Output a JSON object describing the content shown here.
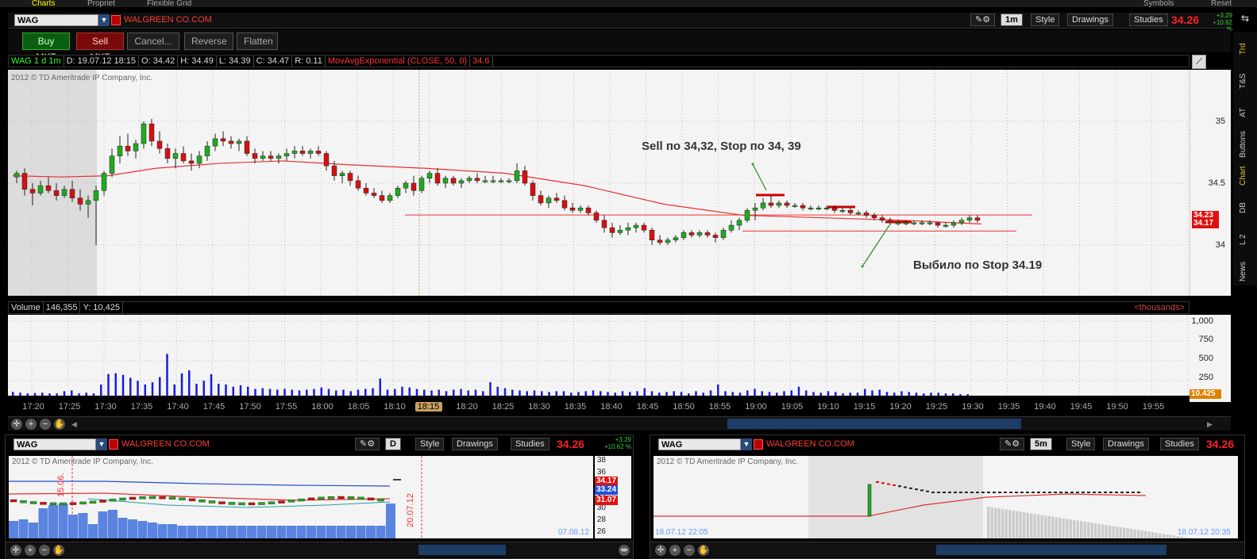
{
  "topbar": {
    "items": [
      "Charts",
      "Propriet",
      "Flexible Grid"
    ],
    "right": [
      "Symbols",
      "Reset"
    ]
  },
  "main": {
    "symbol": "WAG",
    "company": "WALGREEN CO.COM",
    "timeframe": "1m",
    "style": "Style",
    "drawings": "Drawings",
    "studies": "Studies",
    "last": "34.26",
    "chg_up": "+3.29",
    "chg_pct": "+10.62 %",
    "buttons": {
      "buy": "Buy MKT",
      "sell": "Sell MKT",
      "cancel": "Cancel...",
      "reverse": "Reverse",
      "flatten": "Flatten"
    },
    "info": {
      "title": "WAG 1 d 1m",
      "date": "D: 19.07.12 18:15",
      "open": "O: 34.42",
      "high": "H: 34.49",
      "low": "L: 34.39",
      "close": "C: 34.47",
      "range": "R: 0.11",
      "study": "MovAvgExponential (CLOSE, 50, 0)",
      "study_val": "34.6"
    },
    "copyright": "2012 © TD Ameritrade IP Company, Inc.",
    "price_axis": [
      "35",
      "34.5",
      "34"
    ],
    "badges": {
      "a": "34.23",
      "b": "34.17"
    },
    "annotation1": "Sell по 34,32, Stop по 34, 39",
    "annotation2": "Выбило по Stop 34.19",
    "volume": {
      "label": "Volume",
      "value": "146,355",
      "y": "Y: 10,425",
      "unit": "<thousands>",
      "axis": [
        "1,000",
        "750",
        "500",
        "250"
      ],
      "badge": "10.425"
    },
    "time_axis": [
      "17:20",
      "17:25",
      "17:30",
      "17:35",
      "17:40",
      "17:45",
      "17:50",
      "17:55",
      "18:00",
      "18:05",
      "18:10",
      "18:15",
      "18:20",
      "18:25",
      "18:30",
      "18:35",
      "18:40",
      "18:45",
      "18:50",
      "18:55",
      "19:00",
      "19:05",
      "19:10",
      "19:15",
      "19:20",
      "19:25",
      "19:30",
      "19:35",
      "19:40",
      "19:45",
      "19:50",
      "19:55"
    ],
    "cursor_time": "18:15"
  },
  "side_tabs": [
    "Trd",
    "T&S",
    "AT",
    "Buttons",
    "Chart",
    "DB",
    "L 2",
    "News"
  ],
  "bottom_left": {
    "symbol": "WAG",
    "company": "WALGREEN CO.COM",
    "tf": "D",
    "style": "Style",
    "drawings": "Drawings",
    "studies": "Studies",
    "last": "34.26",
    "chg_up": "+3.29",
    "chg_pct": "+10.62 %",
    "copyright": "2012 © TD Ameritrade IP Company, Inc.",
    "axis": [
      "38",
      "36",
      "34",
      "32",
      "30",
      "28",
      "26"
    ],
    "badges": [
      "34.17",
      "33.24",
      "31.07"
    ],
    "date1": "15.06.",
    "date2": "20.07.12",
    "footer": "07.08.12"
  },
  "bottom_right": {
    "symbol": "WAG",
    "company": "WALGREEN CO.COM",
    "tf": "5m",
    "style": "Style",
    "drawings": "Drawings",
    "studies": "Studies",
    "last": "34.26",
    "copyright": "2012 © TD Ameritrade IP Company, Inc.",
    "footer_left": "18.07.12 22:05",
    "footer_right": "18.07.12 20:35"
  },
  "chart_data": {
    "type": "candlestick",
    "note_prices": {
      "sell": 34.32,
      "stop": 34.39,
      "exit": 34.19
    },
    "ema": [
      [
        0,
        34.56
      ],
      [
        60,
        34.55
      ],
      [
        120,
        34.56
      ],
      [
        180,
        34.62
      ],
      [
        260,
        34.66
      ],
      [
        340,
        34.68
      ],
      [
        420,
        34.65
      ],
      [
        520,
        34.62
      ],
      [
        620,
        34.58
      ],
      [
        720,
        34.48
      ],
      [
        820,
        34.33
      ],
      [
        920,
        34.24
      ],
      [
        1020,
        34.22
      ],
      [
        1120,
        34.2
      ],
      [
        1220,
        34.17
      ]
    ],
    "candles": [
      [
        5,
        34.55,
        34.6,
        34.5,
        34.58
      ],
      [
        15,
        34.58,
        34.62,
        34.4,
        34.45
      ],
      [
        25,
        34.45,
        34.5,
        34.32,
        34.42
      ],
      [
        35,
        34.42,
        34.52,
        34.4,
        34.48
      ],
      [
        45,
        34.48,
        34.55,
        34.42,
        34.44
      ],
      [
        55,
        34.44,
        34.5,
        34.36,
        34.4
      ],
      [
        65,
        34.4,
        34.48,
        34.38,
        34.45
      ],
      [
        75,
        34.45,
        34.52,
        34.35,
        34.38
      ],
      [
        85,
        34.38,
        34.45,
        34.28,
        34.33
      ],
      [
        95,
        34.33,
        34.4,
        34.22,
        34.36
      ],
      [
        105,
        34.36,
        34.48,
        34.0,
        34.44
      ],
      [
        115,
        34.44,
        34.6,
        34.4,
        34.58
      ],
      [
        125,
        34.58,
        34.78,
        34.55,
        34.72
      ],
      [
        135,
        34.72,
        34.88,
        34.66,
        34.8
      ],
      [
        145,
        34.8,
        34.9,
        34.72,
        34.76
      ],
      [
        155,
        34.76,
        34.85,
        34.7,
        34.82
      ],
      [
        165,
        34.82,
        35.0,
        34.78,
        34.98
      ],
      [
        175,
        34.98,
        35.02,
        34.8,
        34.84
      ],
      [
        185,
        34.84,
        34.92,
        34.74,
        34.78
      ],
      [
        195,
        34.78,
        34.82,
        34.66,
        34.7
      ],
      [
        205,
        34.7,
        34.78,
        34.62,
        34.74
      ],
      [
        215,
        34.74,
        34.8,
        34.66,
        34.68
      ],
      [
        225,
        34.68,
        34.74,
        34.6,
        34.66
      ],
      [
        235,
        34.66,
        34.76,
        34.62,
        34.72
      ],
      [
        245,
        34.72,
        34.84,
        34.68,
        34.8
      ],
      [
        255,
        34.8,
        34.9,
        34.76,
        34.86
      ],
      [
        265,
        34.86,
        34.92,
        34.8,
        34.84
      ],
      [
        275,
        34.84,
        34.88,
        34.78,
        34.82
      ],
      [
        285,
        34.82,
        34.86,
        34.76,
        34.84
      ],
      [
        295,
        34.84,
        34.88,
        34.72,
        34.74
      ],
      [
        305,
        34.74,
        34.78,
        34.66,
        34.7
      ],
      [
        315,
        34.7,
        34.76,
        34.68,
        34.72
      ],
      [
        325,
        34.72,
        34.76,
        34.68,
        34.7
      ],
      [
        335,
        34.7,
        34.74,
        34.66,
        34.72
      ],
      [
        345,
        34.72,
        34.78,
        34.68,
        34.74
      ],
      [
        355,
        34.74,
        34.8,
        34.7,
        34.76
      ],
      [
        365,
        34.76,
        34.8,
        34.72,
        34.74
      ],
      [
        375,
        34.74,
        34.78,
        34.7,
        34.76
      ],
      [
        385,
        34.76,
        34.8,
        34.72,
        34.74
      ],
      [
        395,
        34.74,
        34.76,
        34.6,
        34.64
      ],
      [
        405,
        34.64,
        34.68,
        34.52,
        34.56
      ],
      [
        415,
        34.56,
        34.6,
        34.5,
        34.58
      ],
      [
        425,
        34.58,
        34.6,
        34.48,
        34.52
      ],
      [
        435,
        34.52,
        34.56,
        34.44,
        34.46
      ],
      [
        445,
        34.46,
        34.5,
        34.4,
        34.42
      ],
      [
        455,
        34.42,
        34.46,
        34.38,
        34.4
      ],
      [
        465,
        34.4,
        34.44,
        34.34,
        34.36
      ],
      [
        475,
        34.36,
        34.42,
        34.34,
        34.4
      ],
      [
        485,
        34.4,
        34.48,
        34.38,
        34.46
      ],
      [
        495,
        34.46,
        34.52,
        34.42,
        34.5
      ],
      [
        505,
        34.5,
        34.56,
        34.4,
        34.44
      ],
      [
        515,
        34.44,
        34.56,
        34.42,
        34.54
      ],
      [
        525,
        34.54,
        34.6,
        34.5,
        34.58
      ],
      [
        535,
        34.58,
        34.62,
        34.48,
        34.5
      ],
      [
        545,
        34.5,
        34.56,
        34.46,
        34.54
      ],
      [
        555,
        34.54,
        34.56,
        34.48,
        34.5
      ],
      [
        565,
        34.5,
        34.54,
        34.46,
        34.52
      ],
      [
        575,
        34.52,
        34.56,
        34.5,
        34.54
      ],
      [
        585,
        34.54,
        34.58,
        34.5,
        34.52
      ],
      [
        595,
        34.52,
        34.56,
        34.5,
        34.52
      ],
      [
        605,
        34.52,
        34.56,
        34.5,
        34.52
      ],
      [
        615,
        34.52,
        34.54,
        34.5,
        34.52
      ],
      [
        625,
        34.52,
        34.54,
        34.5,
        34.52
      ],
      [
        635,
        34.52,
        34.66,
        34.5,
        34.6
      ],
      [
        645,
        34.6,
        34.64,
        34.48,
        34.5
      ],
      [
        655,
        34.5,
        34.52,
        34.36,
        34.4
      ],
      [
        665,
        34.4,
        34.44,
        34.32,
        34.34
      ],
      [
        675,
        34.34,
        34.4,
        34.3,
        34.38
      ],
      [
        685,
        34.38,
        34.42,
        34.34,
        34.36
      ],
      [
        695,
        34.36,
        34.4,
        34.28,
        34.3
      ],
      [
        705,
        34.3,
        34.34,
        34.26,
        34.28
      ],
      [
        715,
        34.28,
        34.32,
        34.26,
        34.3
      ],
      [
        725,
        34.3,
        34.32,
        34.24,
        34.26
      ],
      [
        735,
        34.26,
        34.28,
        34.18,
        34.2
      ],
      [
        745,
        34.2,
        34.24,
        34.1,
        34.14
      ],
      [
        755,
        34.14,
        34.18,
        34.06,
        34.1
      ],
      [
        765,
        34.1,
        34.16,
        34.08,
        34.12
      ],
      [
        775,
        34.12,
        34.18,
        34.08,
        34.14
      ],
      [
        785,
        34.14,
        34.18,
        34.1,
        34.16
      ],
      [
        795,
        34.16,
        34.18,
        34.1,
        34.12
      ],
      [
        805,
        34.12,
        34.14,
        34.0,
        34.04
      ],
      [
        815,
        34.04,
        34.08,
        34.0,
        34.02
      ],
      [
        825,
        34.02,
        34.06,
        34.0,
        34.04
      ],
      [
        835,
        34.04,
        34.08,
        34.02,
        34.06
      ],
      [
        845,
        34.06,
        34.12,
        34.04,
        34.1
      ],
      [
        855,
        34.1,
        34.12,
        34.06,
        34.08
      ],
      [
        865,
        34.08,
        34.12,
        34.06,
        34.1
      ],
      [
        875,
        34.1,
        34.12,
        34.06,
        34.08
      ],
      [
        885,
        34.08,
        34.1,
        34.02,
        34.06
      ],
      [
        895,
        34.06,
        34.14,
        34.04,
        34.12
      ],
      [
        905,
        34.12,
        34.2,
        34.1,
        34.16
      ],
      [
        915,
        34.16,
        34.22,
        34.12,
        34.2
      ],
      [
        925,
        34.2,
        34.3,
        34.18,
        34.28
      ],
      [
        935,
        34.28,
        34.34,
        34.2,
        34.3
      ],
      [
        945,
        34.3,
        34.38,
        34.28,
        34.34
      ],
      [
        955,
        34.34,
        34.4,
        34.3,
        34.32
      ],
      [
        965,
        34.32,
        34.36,
        34.3,
        34.34
      ],
      [
        975,
        34.34,
        34.36,
        34.3,
        34.32
      ],
      [
        985,
        34.32,
        34.34,
        34.3,
        34.32
      ],
      [
        995,
        34.32,
        34.34,
        34.28,
        34.3
      ],
      [
        1005,
        34.3,
        34.32,
        34.28,
        34.3
      ],
      [
        1015,
        34.3,
        34.32,
        34.28,
        34.3
      ],
      [
        1025,
        34.3,
        34.32,
        34.28,
        34.3
      ],
      [
        1035,
        34.3,
        34.32,
        34.26,
        34.28
      ],
      [
        1045,
        34.28,
        34.3,
        34.26,
        34.28
      ],
      [
        1055,
        34.28,
        34.3,
        34.24,
        34.26
      ],
      [
        1065,
        34.26,
        34.28,
        34.24,
        34.26
      ],
      [
        1075,
        34.26,
        34.28,
        34.22,
        34.24
      ],
      [
        1085,
        34.24,
        34.26,
        34.2,
        34.22
      ],
      [
        1095,
        34.22,
        34.24,
        34.18,
        34.2
      ],
      [
        1105,
        34.2,
        34.22,
        34.16,
        34.18
      ],
      [
        1115,
        34.18,
        34.2,
        34.16,
        34.18
      ],
      [
        1125,
        34.18,
        34.2,
        34.16,
        34.18
      ],
      [
        1135,
        34.18,
        34.2,
        34.16,
        34.18
      ],
      [
        1145,
        34.18,
        34.2,
        34.16,
        34.18
      ],
      [
        1155,
        34.18,
        34.2,
        34.16,
        34.18
      ],
      [
        1165,
        34.18,
        34.18,
        34.14,
        34.16
      ],
      [
        1175,
        34.16,
        34.18,
        34.14,
        34.16
      ],
      [
        1185,
        34.16,
        34.2,
        34.14,
        34.18
      ],
      [
        1195,
        34.18,
        34.22,
        34.16,
        34.2
      ],
      [
        1205,
        34.2,
        34.24,
        34.18,
        34.22
      ],
      [
        1215,
        34.22,
        34.24,
        34.18,
        34.2
      ]
    ],
    "volume": [
      50,
      40,
      30,
      35,
      40,
      30,
      30,
      60,
      70,
      30,
      40,
      30,
      150,
      290,
      300,
      280,
      240,
      200,
      150,
      180,
      250,
      560,
      150,
      300,
      340,
      160,
      200,
      290,
      160,
      150,
      120,
      140,
      120,
      90,
      100,
      90,
      80,
      90,
      80,
      70,
      80,
      90,
      110,
      90,
      70,
      80,
      60,
      80,
      90,
      100,
      230,
      80,
      90,
      120,
      110,
      90,
      80,
      70,
      80,
      60,
      80,
      90,
      70,
      80,
      60,
      180,
      120,
      100,
      80,
      70,
      60,
      70,
      60,
      50,
      60,
      60,
      40,
      50,
      60,
      70,
      60,
      50,
      40,
      60,
      50,
      60,
      100,
      60,
      40,
      50,
      60,
      50,
      30,
      60,
      40,
      70,
      150,
      60,
      50,
      40,
      70,
      90,
      60,
      50,
      40,
      60,
      70,
      120,
      70,
      50,
      40,
      60,
      50,
      30,
      40,
      40,
      90,
      70,
      80,
      50,
      40,
      60,
      50,
      40,
      30,
      40,
      40,
      30,
      30,
      20,
      20
    ],
    "sell_level": 34.32,
    "stop_level": 34.39,
    "exit_level": 34.19
  }
}
